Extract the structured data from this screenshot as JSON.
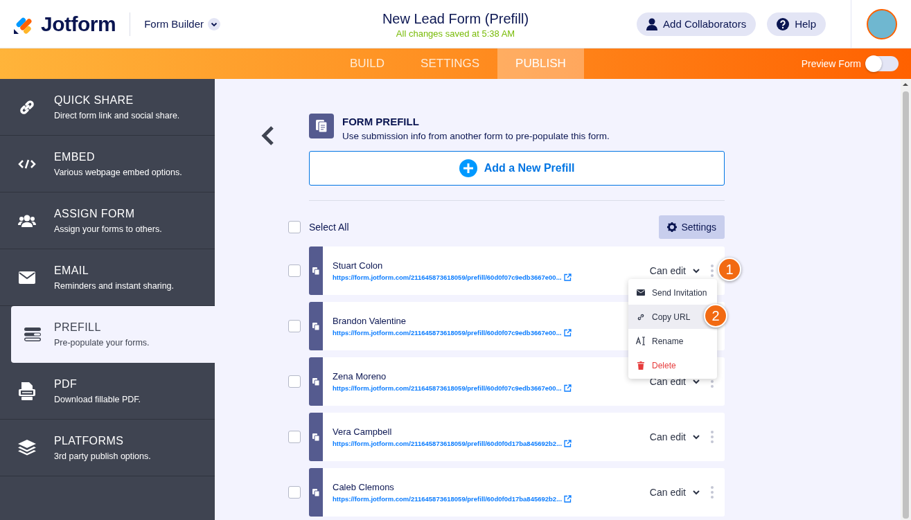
{
  "header": {
    "brand": "Jotform",
    "product": "Form Builder",
    "title": "New Lead Form (Prefill)",
    "status": "All changes saved at 5:38 AM",
    "buttons": [
      {
        "kind": "collaborators",
        "label": "Add Collaborators"
      },
      {
        "kind": "help",
        "label": "Help"
      }
    ]
  },
  "tabs": [
    {
      "label": "BUILD",
      "selected": false
    },
    {
      "label": "SETTINGS",
      "selected": false
    },
    {
      "label": "PUBLISH",
      "selected": true
    }
  ],
  "preview": {
    "label": "Preview Form",
    "on": false
  },
  "sidebar": {
    "items": [
      {
        "kind": "link",
        "title": "QUICK SHARE",
        "subtitle": "Direct form link and social share.",
        "selected": false
      },
      {
        "kind": "code",
        "title": "EMBED",
        "subtitle": "Various webpage embed options.",
        "selected": false
      },
      {
        "kind": "users",
        "title": "ASSIGN FORM",
        "subtitle": "Assign your forms to others.",
        "selected": false
      },
      {
        "kind": "mail",
        "title": "EMAIL",
        "subtitle": "Reminders and instant sharing.",
        "selected": false
      },
      {
        "kind": "prefill",
        "title": "PREFILL",
        "subtitle": "Pre-populate your forms.",
        "selected": true
      },
      {
        "kind": "pdf",
        "title": "PDF",
        "subtitle": "Download fillable PDF.",
        "selected": false
      },
      {
        "kind": "layers",
        "title": "PLATFORMS",
        "subtitle": "3rd party publish options.",
        "selected": false
      }
    ]
  },
  "panel": {
    "title": "FORM PREFILL",
    "description": "Use submission info from another form to pre-populate this form.",
    "add_button": "Add a New Prefill",
    "select_all": {
      "label": "Select All",
      "checked": false
    },
    "settings_button": "Settings",
    "rows": [
      {
        "name": "Stuart Colon",
        "url": "https://form.jotform.com/211645873618059/prefill/60d0f07c9edb3667e00...",
        "access": "Can edit",
        "checked": false
      },
      {
        "name": "Brandon Valentine",
        "url": "https://form.jotform.com/211645873618059/prefill/60d0f07c9edb3667e00...",
        "checked": false
      },
      {
        "name": "Zena Moreno",
        "url": "https://form.jotform.com/211645873618059/prefill/60d0f07c9edb3667e00...",
        "access": "Can edit",
        "checked": false
      },
      {
        "name": "Vera Campbell",
        "url": "https://form.jotform.com/211645873618059/prefill/60d0f0d17ba845692b2...",
        "access": "Can edit",
        "checked": false
      },
      {
        "name": "Caleb Clemons",
        "url": "https://form.jotform.com/211645873618059/prefill/60d0f0d17ba845692b2...",
        "access": "Can edit",
        "checked": false
      }
    ],
    "menu": [
      {
        "kind": "mail",
        "label": "Send Invitation",
        "selected": false
      },
      {
        "kind": "link",
        "label": "Copy URL",
        "selected": true
      },
      {
        "kind": "rename",
        "label": "Rename",
        "selected": false
      },
      {
        "kind": "delete",
        "label": "Delete",
        "selected": false
      }
    ],
    "annotations": [
      {
        "label": "1"
      },
      {
        "label": "2"
      }
    ]
  }
}
